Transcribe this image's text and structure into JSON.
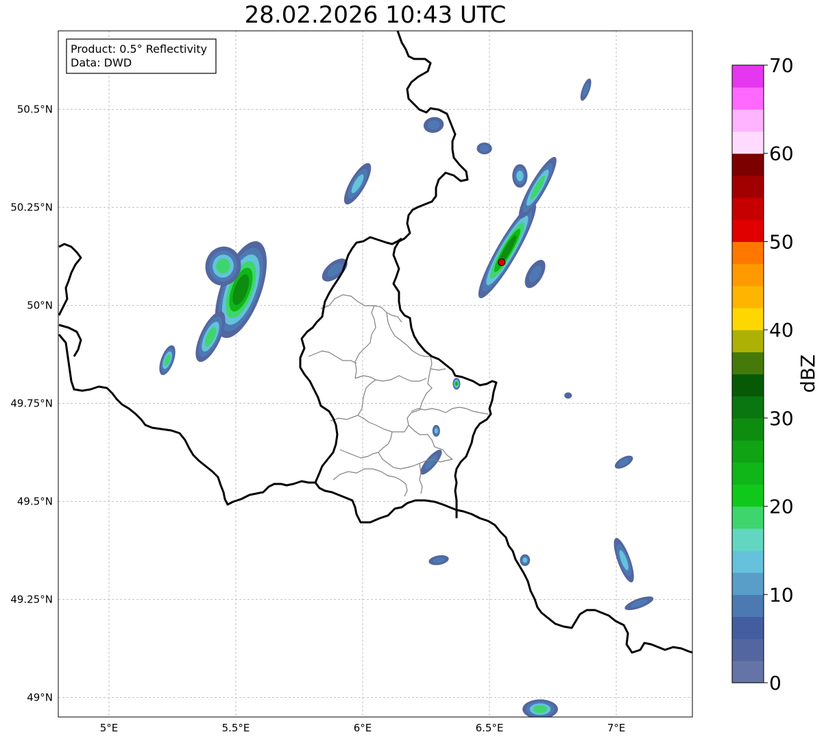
{
  "title": "28.02.2026 10:43 UTC",
  "info_box": {
    "product": "Product: 0.5° Reflectivity",
    "data": "Data: DWD"
  },
  "map": {
    "lon_range": [
      4.8,
      7.3
    ],
    "lat_range": [
      48.95,
      50.7
    ],
    "grid": true,
    "lon_ticks": [
      {
        "value": 5.0,
        "label": "5°E"
      },
      {
        "value": 5.5,
        "label": "5.5°E"
      },
      {
        "value": 6.0,
        "label": "6°E"
      },
      {
        "value": 6.5,
        "label": "6.5°E"
      },
      {
        "value": 7.0,
        "label": "7°E"
      }
    ],
    "lat_ticks": [
      {
        "value": 49.0,
        "label": "49°N"
      },
      {
        "value": 49.25,
        "label": "49.25°N"
      },
      {
        "value": 49.5,
        "label": "49.5°N"
      },
      {
        "value": 49.75,
        "label": "49.75°N"
      },
      {
        "value": 50.0,
        "label": "50°N"
      },
      {
        "value": 50.25,
        "label": "50.25°N"
      },
      {
        "value": 50.5,
        "label": "50.5°N"
      }
    ],
    "radar_site": {
      "lon": 6.548,
      "lat": 50.11,
      "color": "#e00000"
    }
  },
  "colorbar": {
    "label": "dBZ",
    "min": 0,
    "max": 70,
    "tick_values": [
      0,
      10,
      20,
      30,
      40,
      50,
      60,
      70
    ],
    "tick_labels": [
      "0",
      "10",
      "20",
      "30",
      "40",
      "50",
      "60",
      "70"
    ],
    "colors": [
      "#6574a6",
      "#5366a0",
      "#435ea0",
      "#4d79b2",
      "#589ec8",
      "#65c1dc",
      "#63d6c2",
      "#3ed66c",
      "#10c81b",
      "#10b518",
      "#10a314",
      "#0d8c10",
      "#0a7610",
      "#065a06",
      "#457a0a",
      "#adb104",
      "#fed700",
      "#feb500",
      "#fe9900",
      "#fe7800",
      "#e10000",
      "#c60000",
      "#a10000",
      "#7c0000",
      "#ffdcff",
      "#ffb4ff",
      "#ff69ff",
      "#e437ef"
    ]
  },
  "echoes": [
    {
      "lon": 5.52,
      "lat": 50.04,
      "rx": 0.08,
      "ry": 0.13,
      "rot": 20,
      "max_dbz": 28
    },
    {
      "lon": 5.45,
      "lat": 50.1,
      "rx": 0.07,
      "ry": 0.05,
      "rot": 10,
      "max_dbz": 20
    },
    {
      "lon": 5.4,
      "lat": 49.92,
      "rx": 0.04,
      "ry": 0.07,
      "rot": 25,
      "max_dbz": 18
    },
    {
      "lon": 5.23,
      "lat": 49.86,
      "rx": 0.025,
      "ry": 0.04,
      "rot": 20,
      "max_dbz": 18
    },
    {
      "lon": 5.98,
      "lat": 50.31,
      "rx": 0.03,
      "ry": 0.06,
      "rot": 30,
      "max_dbz": 14
    },
    {
      "lon": 5.89,
      "lat": 50.09,
      "rx": 0.06,
      "ry": 0.02,
      "rot": -40,
      "max_dbz": 10
    },
    {
      "lon": 6.57,
      "lat": 50.14,
      "rx": 0.04,
      "ry": 0.14,
      "rot": 30,
      "max_dbz": 28
    },
    {
      "lon": 6.69,
      "lat": 50.3,
      "rx": 0.03,
      "ry": 0.09,
      "rot": 30,
      "max_dbz": 20
    },
    {
      "lon": 6.62,
      "lat": 50.33,
      "rx": 0.03,
      "ry": 0.03,
      "rot": 0,
      "max_dbz": 14
    },
    {
      "lon": 6.68,
      "lat": 50.08,
      "rx": 0.03,
      "ry": 0.04,
      "rot": 30,
      "max_dbz": 10
    },
    {
      "lon": 6.48,
      "lat": 50.4,
      "rx": 0.03,
      "ry": 0.015,
      "rot": 0,
      "max_dbz": 8
    },
    {
      "lon": 6.28,
      "lat": 50.46,
      "rx": 0.04,
      "ry": 0.02,
      "rot": -10,
      "max_dbz": 8
    },
    {
      "lon": 6.88,
      "lat": 50.55,
      "rx": 0.015,
      "ry": 0.03,
      "rot": 20,
      "max_dbz": 8
    },
    {
      "lon": 6.37,
      "lat": 49.8,
      "rx": 0.015,
      "ry": 0.015,
      "rot": 0,
      "max_dbz": 24
    },
    {
      "lon": 6.27,
      "lat": 49.6,
      "rx": 0.02,
      "ry": 0.04,
      "rot": 40,
      "max_dbz": 12
    },
    {
      "lon": 6.29,
      "lat": 49.68,
      "rx": 0.015,
      "ry": 0.015,
      "rot": 0,
      "max_dbz": 14
    },
    {
      "lon": 7.03,
      "lat": 49.35,
      "rx": 0.025,
      "ry": 0.06,
      "rot": -20,
      "max_dbz": 14
    },
    {
      "lon": 7.09,
      "lat": 49.24,
      "rx": 0.06,
      "ry": 0.012,
      "rot": -20,
      "max_dbz": 12
    },
    {
      "lon": 6.64,
      "lat": 49.35,
      "rx": 0.02,
      "ry": 0.015,
      "rot": 0,
      "max_dbz": 14
    },
    {
      "lon": 6.3,
      "lat": 49.35,
      "rx": 0.04,
      "ry": 0.012,
      "rot": -10,
      "max_dbz": 10
    },
    {
      "lon": 6.7,
      "lat": 48.97,
      "rx": 0.07,
      "ry": 0.025,
      "rot": 0,
      "max_dbz": 22
    },
    {
      "lon": 7.03,
      "lat": 49.6,
      "rx": 0.04,
      "ry": 0.012,
      "rot": -30,
      "max_dbz": 8
    },
    {
      "lon": 6.81,
      "lat": 49.77,
      "rx": 0.015,
      "ry": 0.008,
      "rot": 0,
      "max_dbz": 6
    }
  ]
}
